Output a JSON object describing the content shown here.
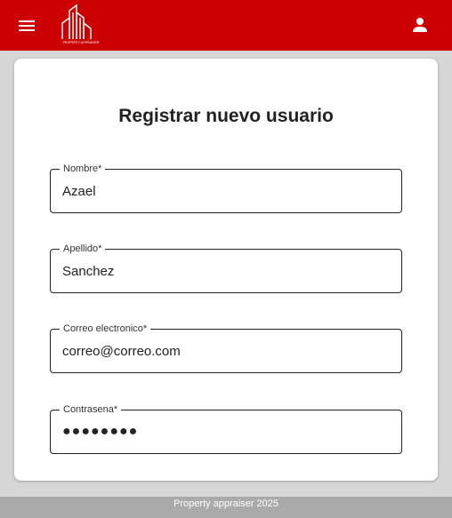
{
  "header": {
    "menu_icon": "menu-icon",
    "logo_text": "PROPERTY APPRAISER",
    "account_icon": "person-icon"
  },
  "form": {
    "title": "Registrar nuevo usuario",
    "fields": [
      {
        "label": "Nombre*",
        "value": "Azael"
      },
      {
        "label": "Apellido*",
        "value": "Sanchez"
      },
      {
        "label": "Correo electronico*",
        "value": "correo@correo.com"
      },
      {
        "label": "Contrasena*",
        "value": "●●●●●●●●"
      }
    ]
  },
  "footer": {
    "text": "Property appraiser 2025"
  },
  "colors": {
    "appbar": "#cc0000",
    "background": "#d6d6d6",
    "footer": "#aaaaaa"
  }
}
